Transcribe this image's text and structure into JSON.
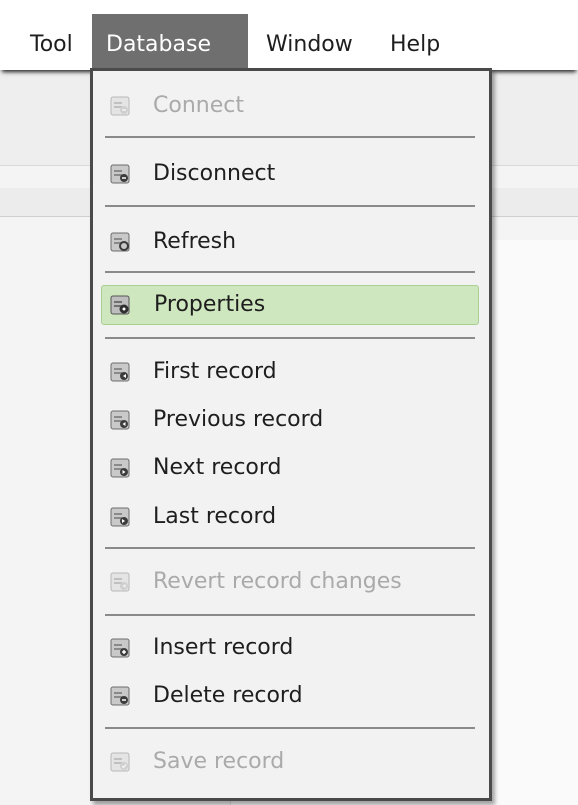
{
  "menubar": {
    "items": [
      "Tool",
      "Database",
      "Window",
      "Help"
    ],
    "active": "Database"
  },
  "database_menu": {
    "items": {
      "connect": {
        "label": "Connect",
        "enabled": false,
        "icon": "connect-icon"
      },
      "disconnect": {
        "label": "Disconnect",
        "enabled": true,
        "icon": "disconnect-icon"
      },
      "refresh": {
        "label": "Refresh",
        "enabled": true,
        "icon": "refresh-icon"
      },
      "properties": {
        "label": "Properties",
        "enabled": true,
        "highlighted": true,
        "icon": "properties-icon"
      },
      "first_record": {
        "label": "First record",
        "enabled": true,
        "icon": "first-record-icon"
      },
      "previous_record": {
        "label": "Previous record",
        "enabled": true,
        "icon": "previous-record-icon"
      },
      "next_record": {
        "label": "Next record",
        "enabled": true,
        "icon": "next-record-icon"
      },
      "last_record": {
        "label": "Last record",
        "enabled": true,
        "icon": "last-record-icon"
      },
      "revert_record_changes": {
        "label": "Revert record changes",
        "enabled": false,
        "icon": "revert-icon"
      },
      "insert_record": {
        "label": "Insert record",
        "enabled": true,
        "icon": "insert-record-icon"
      },
      "delete_record": {
        "label": "Delete record",
        "enabled": true,
        "icon": "delete-record-icon"
      },
      "save_record": {
        "label": "Save record",
        "enabled": false,
        "icon": "save-record-icon"
      }
    }
  },
  "colors": {
    "menubar_active_bg": "#6f6f6f",
    "menu_bg": "#f2f2f2",
    "menu_border": "#4a4a4a",
    "highlight_bg": "#cfe7be",
    "highlight_border": "#a9cf91",
    "disabled_text": "#aaaaaa"
  }
}
